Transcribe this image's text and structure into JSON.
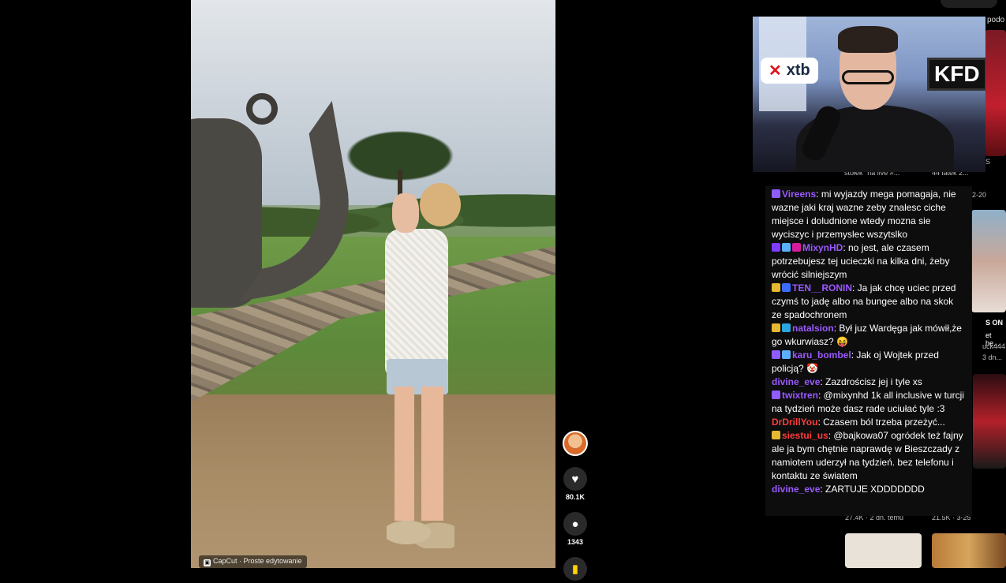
{
  "video": {
    "watermark": "CapCut · Proste edytowanie",
    "watermark_icon": "capcut-icon"
  },
  "actions": {
    "like_count": "80.1K",
    "comment_count": "1343",
    "icons": [
      "avatar",
      "heart-icon",
      "comment-icon",
      "bookmark-icon"
    ]
  },
  "stream_overlay": {
    "brand_left": "xtb",
    "brand_right": "KFD"
  },
  "header": {
    "nav_text": "podo"
  },
  "background_feed": {
    "labels": [
      "stołek\" na live #...",
      "44 latek 2...",
      "S",
      "S ON",
      "et he...",
      "uck444",
      "3 dn...",
      "27.4K · 2 dn. temu",
      "21.5K · 3-25",
      "2-20"
    ]
  },
  "chat": {
    "messages": [
      {
        "nick": "Vireens",
        "nick_color": "#9b59ff",
        "badges": [
          "#8f5cff"
        ],
        "text": ": mi wyjazdy mega pomagaja, nie wazne jaki kraj wazne zeby znalesc ciche miejsce i doludnione wtedy mozna sie wyciszyc i przemyslec wszytslko"
      },
      {
        "nick": "MixynHD",
        "nick_color": "#9b59ff",
        "badges": [
          "#7d3cff",
          "#5ab0ff",
          "#d61c9d"
        ],
        "text": ": no jest, ale czasem potrzebujesz tej ucieczki na kilka dni, żeby wrócić silniejszym"
      },
      {
        "nick": "TEN__RONIN",
        "nick_color": "#9b59ff",
        "badges": [
          "#e6b832",
          "#3b6bff"
        ],
        "text": ": Ja jak chcę uciec przed czymś to jadę albo na bungee albo na skok ze spadochronem"
      },
      {
        "nick": "natalsion",
        "nick_color": "#9b59ff",
        "badges": [
          "#e6b832",
          "#2aa7e0"
        ],
        "text": ": Był juz Wardęga jak mówił,że go wkurwiasz? 😝"
      },
      {
        "nick": "karu_bombel",
        "nick_color": "#9b59ff",
        "badges": [
          "#8f5cff",
          "#5ab0ff"
        ],
        "text": ": Jak oj Wojtek przed policją? 🤡"
      },
      {
        "nick": "divine_eve",
        "nick_color": "#9b59ff",
        "badges": [],
        "text": ": Zazdrościsz jej i tyle xs"
      },
      {
        "nick": "twixtren",
        "nick_color": "#9b59ff",
        "badges": [
          "#8f5cff"
        ],
        "text": ": @mixynhd 1k all inclusive w turcji na tydzień może dasz rade uciułać tyle :3"
      },
      {
        "nick": "DrDrillYou",
        "nick_color": "#ff3b3b",
        "badges": [],
        "text": ": Czasem ból trzeba przeżyć..."
      },
      {
        "nick": "siestui_us",
        "nick_color": "#ff3b3b",
        "badges": [
          "#e6b832"
        ],
        "text": ": @bajkowa07 ogródek też fajny ale ja bym chętnie naprawdę w Bieszczady z namiotem uderzył na tydzień. bez telefonu i kontaktu ze światem"
      },
      {
        "nick": "divine_eve",
        "nick_color": "#9b59ff",
        "badges": [],
        "text": ": ZARTUJE XDDDDDDD"
      }
    ]
  }
}
